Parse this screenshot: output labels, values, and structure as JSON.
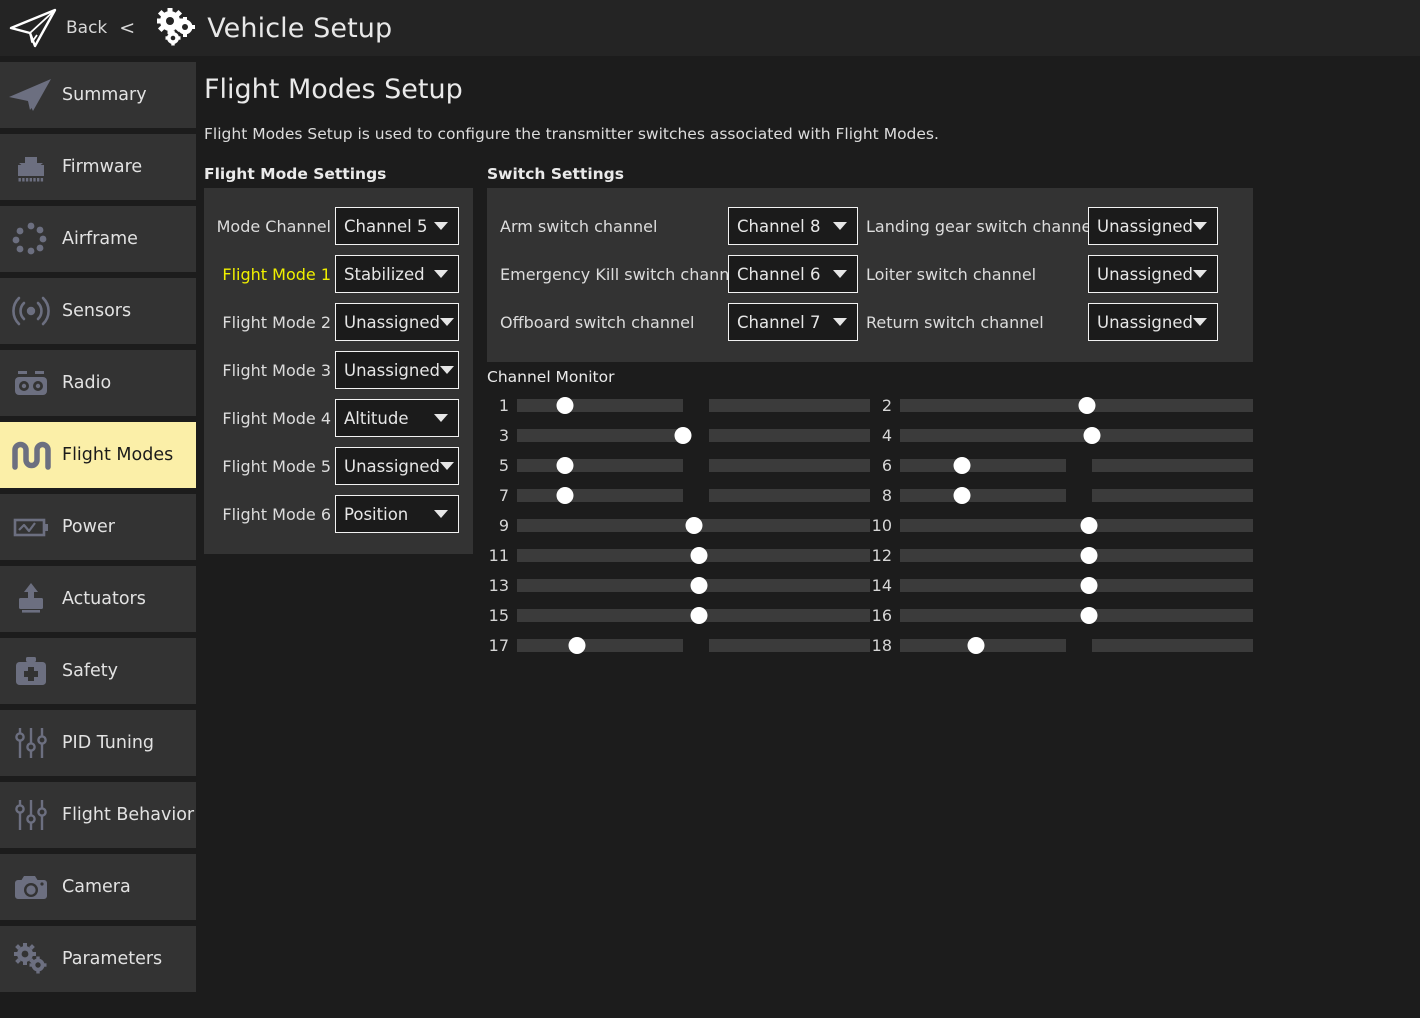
{
  "topbar": {
    "app_icon": "paper-plane-icon",
    "back_label": "Back",
    "back_chevron": "<",
    "title_icon": "gears-icon",
    "title": "Vehicle Setup"
  },
  "sidebar": {
    "items": [
      {
        "label": "Summary",
        "icon": "paper-plane-icon",
        "selected": false
      },
      {
        "label": "Firmware",
        "icon": "download-chip-icon",
        "selected": false
      },
      {
        "label": "Airframe",
        "icon": "airframe-dots-icon",
        "selected": false
      },
      {
        "label": "Sensors",
        "icon": "signal-waves-icon",
        "selected": false
      },
      {
        "label": "Radio",
        "icon": "transmitter-icon",
        "selected": false
      },
      {
        "label": "Flight Modes",
        "icon": "waveform-icon",
        "selected": true
      },
      {
        "label": "Power",
        "icon": "battery-icon",
        "selected": false
      },
      {
        "label": "Actuators",
        "icon": "actuator-icon",
        "selected": false
      },
      {
        "label": "Safety",
        "icon": "first-aid-kit-icon",
        "selected": false
      },
      {
        "label": "PID Tuning",
        "icon": "sliders-icon",
        "selected": false
      },
      {
        "label": "Flight Behavior",
        "icon": "sliders-icon",
        "selected": false
      },
      {
        "label": "Camera",
        "icon": "camera-icon",
        "selected": false
      },
      {
        "label": "Parameters",
        "icon": "gears-icon",
        "selected": false
      }
    ]
  },
  "main": {
    "title": "Flight Modes Setup",
    "description": "Flight Modes Setup is used to configure the transmitter switches associated with Flight Modes.",
    "flight_mode_settings": {
      "heading": "Flight Mode Settings",
      "rows": [
        {
          "label": "Mode Channel",
          "value": "Channel 5",
          "highlight": false
        },
        {
          "label": "Flight Mode 1",
          "value": "Stabilized",
          "highlight": true
        },
        {
          "label": "Flight Mode 2",
          "value": "Unassigned",
          "highlight": false
        },
        {
          "label": "Flight Mode 3",
          "value": "Unassigned",
          "highlight": false
        },
        {
          "label": "Flight Mode 4",
          "value": "Altitude",
          "highlight": false
        },
        {
          "label": "Flight Mode 5",
          "value": "Unassigned",
          "highlight": false
        },
        {
          "label": "Flight Mode 6",
          "value": "Position",
          "highlight": false
        }
      ]
    },
    "switch_settings": {
      "heading": "Switch Settings",
      "rows": [
        {
          "left_label": "Arm switch channel",
          "left_value": "Channel 8",
          "right_label": "Landing gear switch channel",
          "right_value": "Unassigned"
        },
        {
          "left_label": "Emergency Kill switch channel",
          "left_value": "Channel 6",
          "right_label": "Loiter switch channel",
          "right_value": "Unassigned"
        },
        {
          "left_label": "Offboard switch channel",
          "left_value": "Channel 7",
          "right_label": "Return switch channel",
          "right_value": "Unassigned"
        }
      ]
    },
    "channel_monitor": {
      "heading": "Channel Monitor",
      "channels": [
        {
          "number": "1",
          "position_pct": 13.5,
          "split": true
        },
        {
          "number": "2",
          "position_pct": 53.0,
          "split": false
        },
        {
          "number": "3",
          "position_pct": 47.0,
          "split": true
        },
        {
          "number": "4",
          "position_pct": 54.5,
          "split": false
        },
        {
          "number": "5",
          "position_pct": 13.5,
          "split": true
        },
        {
          "number": "6",
          "position_pct": 17.5,
          "split": true
        },
        {
          "number": "7",
          "position_pct": 13.5,
          "split": true
        },
        {
          "number": "8",
          "position_pct": 17.5,
          "split": true
        },
        {
          "number": "9",
          "position_pct": 50.0,
          "split": false
        },
        {
          "number": "10",
          "position_pct": 53.5,
          "split": false
        },
        {
          "number": "11",
          "position_pct": 51.5,
          "split": false
        },
        {
          "number": "12",
          "position_pct": 53.5,
          "split": false
        },
        {
          "number": "13",
          "position_pct": 51.5,
          "split": false
        },
        {
          "number": "14",
          "position_pct": 53.5,
          "split": false
        },
        {
          "number": "15",
          "position_pct": 51.5,
          "split": false
        },
        {
          "number": "16",
          "position_pct": 53.5,
          "split": false
        },
        {
          "number": "17",
          "position_pct": 17.0,
          "split": true
        },
        {
          "number": "18",
          "position_pct": 21.5,
          "split": true
        }
      ]
    }
  },
  "colors": {
    "page_bg": "#1c1c1c",
    "topbar_bg": "#242424",
    "panel_bg": "#333333",
    "combo_bg": "#1b1b1b",
    "combo_border": "#f2f2f2",
    "text": "#e2e2e2",
    "selected_bg": "#fbefa8",
    "highlight_text": "#f0f000",
    "track": "#3b3b3b",
    "thumb": "#ffffff",
    "icon_gray": "#6c6f80"
  }
}
